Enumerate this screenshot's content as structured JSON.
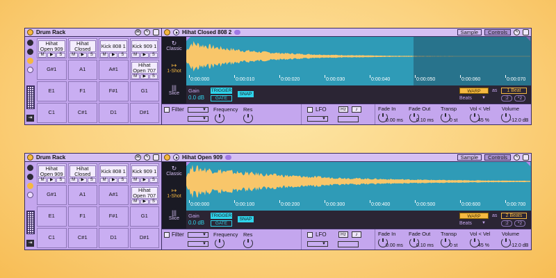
{
  "panels": [
    {
      "rack": {
        "title": "Drum Rack",
        "pads": [
          {
            "name": "Hihat Open 909",
            "filled": true
          },
          {
            "name": "Hihat Closed",
            "filled": true
          },
          {
            "name": "Kick 808 1",
            "filled": true
          },
          {
            "name": "Kick 909 1",
            "filled": true
          },
          {
            "name": "G#1",
            "filled": false
          },
          {
            "name": "A1",
            "filled": false
          },
          {
            "name": "A#1",
            "filled": false
          },
          {
            "name": "Hihat Open 707",
            "filled": true
          },
          {
            "name": "E1",
            "filled": false
          },
          {
            "name": "F1",
            "filled": false
          },
          {
            "name": "F#1",
            "filled": false
          },
          {
            "name": "G1",
            "filled": false
          },
          {
            "name": "C1",
            "filled": false
          },
          {
            "name": "C#1",
            "filled": false
          },
          {
            "name": "D1",
            "filled": false
          },
          {
            "name": "D#1",
            "filled": false
          }
        ],
        "pad_buttons": [
          "M",
          "▶",
          "S"
        ]
      },
      "simpler": {
        "title": "Hihat Closed 808 2",
        "tabs": [
          "Sample",
          "Controls"
        ],
        "modes": [
          {
            "label": "Classic",
            "glyph": "↻"
          },
          {
            "label": "1-Shot",
            "glyph": "↦"
          },
          {
            "label": "Slice",
            "glyph": "|||"
          }
        ],
        "active_mode": 1,
        "timeline": [
          "0:00:000",
          "0:00:010",
          "0:00:020",
          "0:00:030",
          "0:00:040",
          "0:00:050",
          "0:00:060",
          "0:00:070"
        ],
        "shade_start": 0.66,
        "decay": 5.5,
        "gain_label": "Gain",
        "gain_value": "0.0 dB",
        "trigger": "TRIGGER",
        "gate": "GATE",
        "snap": "SNAP",
        "warp": "WARP",
        "as": "as",
        "beats_value": "1 Beat",
        "beats_label": "Beats",
        "half": ":2",
        "double": "*2",
        "filter": "Filter",
        "frequency": "Frequency",
        "res": "Res",
        "lfo": "LFO",
        "hz": "Hz",
        "note": "♪",
        "fade_in": "Fade In",
        "fade_in_value": "0.00 ms",
        "fade_out": "Fade Out",
        "fade_out_value": "0.10 ms",
        "transp": "Transp",
        "transp_value": "0 st",
        "vol_vel": "Vol < Vel",
        "vol_vel_value": "45 %",
        "volume": "Volume",
        "volume_value": "-12.0 dB"
      }
    },
    {
      "rack": {
        "title": "Drum Rack",
        "pads": [
          {
            "name": "Hihat Open 909",
            "filled": true
          },
          {
            "name": "Hihat Closed",
            "filled": true
          },
          {
            "name": "Kick 808 1",
            "filled": true
          },
          {
            "name": "Kick 909 1",
            "filled": true
          },
          {
            "name": "G#1",
            "filled": false
          },
          {
            "name": "A1",
            "filled": false
          },
          {
            "name": "A#1",
            "filled": false
          },
          {
            "name": "Hihat Open 707",
            "filled": true
          },
          {
            "name": "E1",
            "filled": false
          },
          {
            "name": "F1",
            "filled": false
          },
          {
            "name": "F#1",
            "filled": false
          },
          {
            "name": "G1",
            "filled": false
          },
          {
            "name": "C1",
            "filled": false
          },
          {
            "name": "C#1",
            "filled": false
          },
          {
            "name": "D1",
            "filled": false
          },
          {
            "name": "D#1",
            "filled": false
          }
        ],
        "pad_buttons": [
          "M",
          "▶",
          "S"
        ]
      },
      "simpler": {
        "title": "Hihat Open 909",
        "tabs": [
          "Sample",
          "Controls"
        ],
        "modes": [
          {
            "label": "Classic",
            "glyph": "↻"
          },
          {
            "label": "1-Shot",
            "glyph": "↦"
          },
          {
            "label": "Slice",
            "glyph": "|||"
          }
        ],
        "active_mode": 1,
        "timeline": [
          "0:00:000",
          "0:00:100",
          "0:00:200",
          "0:00:300",
          "0:00:400",
          "0:00:500",
          "0:00:600",
          "0:00:700"
        ],
        "shade_start": 1.0,
        "decay": 3.2,
        "gain_label": "Gain",
        "gain_value": "0.0 dB",
        "trigger": "TRIGGER",
        "gate": "GATE",
        "snap": "SNAP",
        "warp": "WARP",
        "as": "as",
        "beats_value": "2 Beats",
        "beats_label": "Beats",
        "half": ":2",
        "double": "*2",
        "filter": "Filter",
        "frequency": "Frequency",
        "res": "Res",
        "lfo": "LFO",
        "hz": "Hz",
        "note": "♪",
        "fade_in": "Fade In",
        "fade_in_value": "0.00 ms",
        "fade_out": "Fade Out",
        "fade_out_value": "0.10 ms",
        "transp": "Transp",
        "transp_value": "0 st",
        "vol_vel": "Vol < Vel",
        "vol_vel_value": "45 %",
        "volume": "Volume",
        "volume_value": "-12.0 dB"
      }
    }
  ],
  "colors": {
    "panel": "#c4a6ee",
    "waveform_bg": "#2f9bb7",
    "waveform": "#f8c66a",
    "accent_cyan": "#2fd3ea",
    "accent_orange": "#f5b841"
  }
}
